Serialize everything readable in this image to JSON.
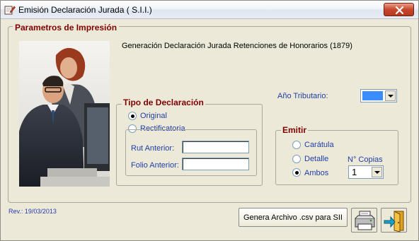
{
  "window": {
    "title": "Emisión Declaración Jurada ( S.I.I.)"
  },
  "panel": {
    "legend": "Parametros de Impresión",
    "subtitle": "Generación Declaración Jurada Retenciones de Honorarios (1879)"
  },
  "tipo": {
    "legend": "Tipo de Declaración",
    "original": "Original",
    "rectificatoria": "Rectificatoria",
    "selected": "original",
    "rut_label": "Rut Anterior:",
    "rut_value": "",
    "folio_label": "Folio Anterior:",
    "folio_value": ""
  },
  "anio": {
    "label": "Año Tributario:",
    "value": ""
  },
  "emitir": {
    "legend": "Emitir",
    "caratula": "Carátula",
    "detalle": "Detalle",
    "ambos": "Ambos",
    "selected": "ambos",
    "copias_label": "N° Copias",
    "copias_value": "1"
  },
  "footer": {
    "rev": "Rev.: 19/03/2013",
    "genera_button": "Genera Archivo .csv para SII"
  },
  "icons": {
    "title": "app-edit-icon",
    "print": "printer-icon",
    "exit": "exit-door-icon"
  },
  "colors": {
    "accent_red": "#800000",
    "label_blue": "#1f3ea8",
    "close": "#c8452b",
    "combo_fill": "#3b8cff"
  }
}
